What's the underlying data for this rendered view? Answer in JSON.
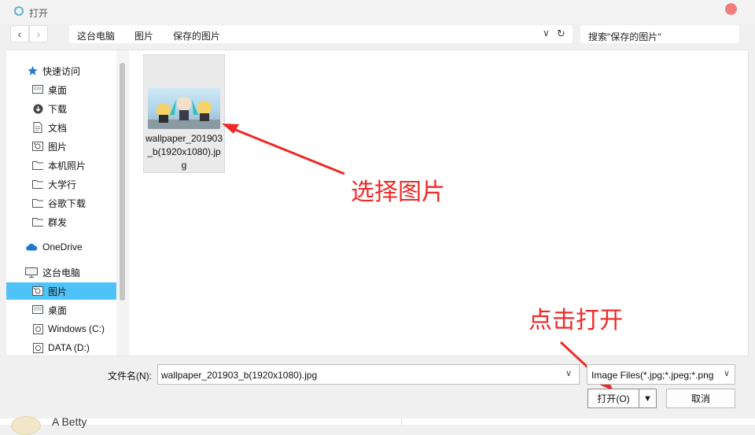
{
  "window": {
    "title": "打开"
  },
  "toolbar": {
    "breadcrumbs": [
      "这台电脑",
      "图片",
      "保存的图片"
    ],
    "search_placeholder": "搜索\"保存的图片\""
  },
  "nav": {
    "items": [
      {
        "label": "快速访问",
        "icon": "star-icon"
      },
      {
        "label": "桌面",
        "icon": "desktop-icon"
      },
      {
        "label": "下载",
        "icon": "download-icon"
      },
      {
        "label": "文档",
        "icon": "document-icon"
      },
      {
        "label": "图片",
        "icon": "pictures-icon"
      },
      {
        "label": "本机照片",
        "icon": "folder-icon"
      },
      {
        "label": "大学行",
        "icon": "folder-icon"
      },
      {
        "label": "谷歌下载",
        "icon": "folder-icon"
      },
      {
        "label": "群发",
        "icon": "folder-icon"
      },
      {
        "label": "OneDrive",
        "icon": "cloud-icon"
      },
      {
        "label": "这台电脑",
        "icon": "computer-icon"
      },
      {
        "label": "图片",
        "icon": "pictures-icon",
        "selected": true
      },
      {
        "label": "桌面",
        "icon": "desktop-icon"
      },
      {
        "label": "Windows (C:)",
        "icon": "drive-icon"
      },
      {
        "label": "DATA (D:)",
        "icon": "drive-icon"
      }
    ]
  },
  "files": [
    {
      "name": "wallpaper_201903_b(1920x1080).jpg"
    }
  ],
  "annotations": {
    "select_image": "选择图片",
    "click_open": "点击打开"
  },
  "bottom": {
    "filename_label": "文件名(N):",
    "filename_value": "wallpaper_201903_b(1920x1080).jpg",
    "filetype_value": "Image Files(*.jpg;*.jpeg;*.png",
    "open_label": "打开(O)",
    "cancel_label": "取消"
  },
  "background_app": {
    "contact_name": "A Betty"
  },
  "colors": {
    "accent": "#4fc3f7",
    "annotation": "#ee2a26",
    "close": "#f07c7c"
  }
}
